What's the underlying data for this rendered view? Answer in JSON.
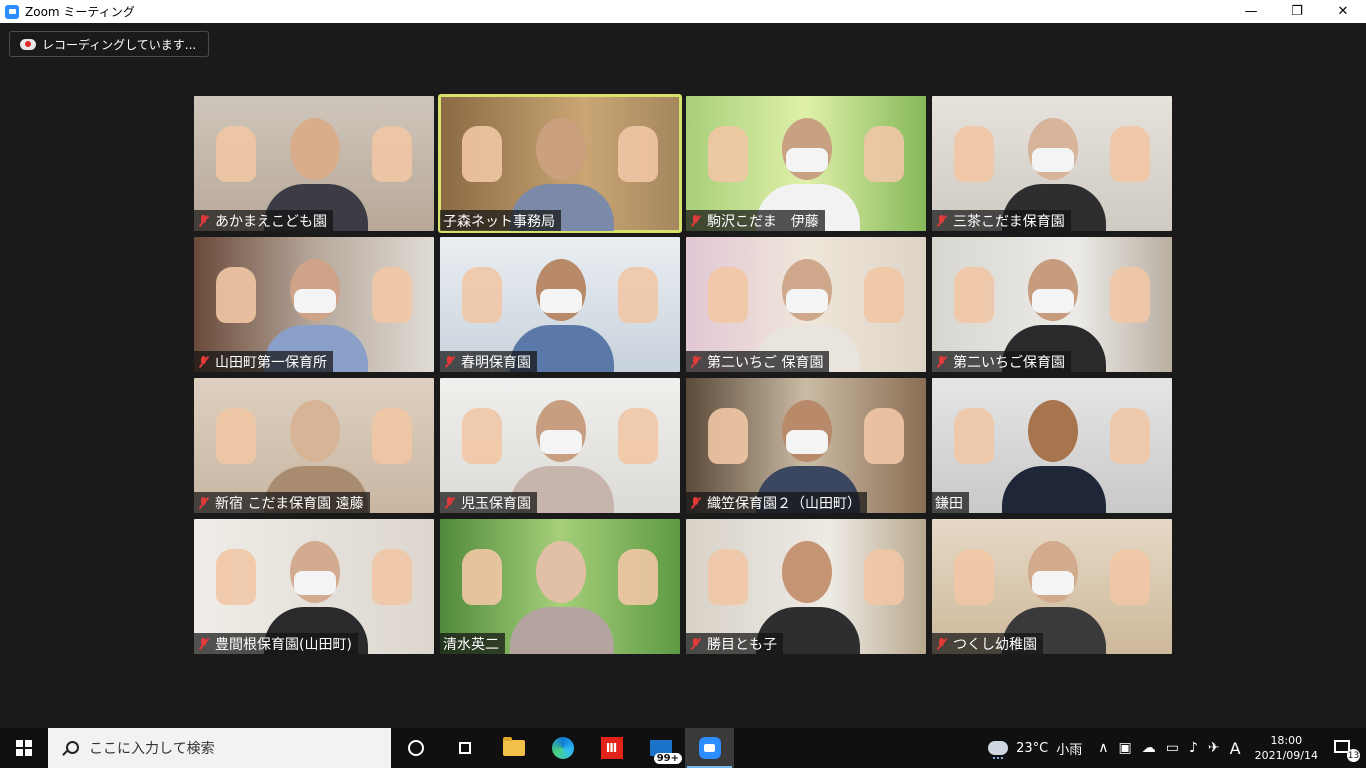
{
  "window": {
    "title": "Zoom ミーティング",
    "minimize": "—",
    "maximize": "❐",
    "close": "✕"
  },
  "recording": {
    "label": "レコーディングしています..."
  },
  "participants": [
    {
      "name": "あかまえこども園",
      "muted": true
    },
    {
      "name": "子森ネット事務局",
      "muted": false,
      "active_speaker": true
    },
    {
      "name": "駒沢こだま　伊藤",
      "muted": true
    },
    {
      "name": "三茶こだま保育園",
      "muted": true
    },
    {
      "name": "山田町第一保育所",
      "muted": true
    },
    {
      "name": "春明保育園",
      "muted": true
    },
    {
      "name": "第二いちご 保育園",
      "muted": true
    },
    {
      "name": "第二いちご保育園",
      "muted": true
    },
    {
      "name": "新宿 こだま保育園 遠藤",
      "muted": true
    },
    {
      "name": "児玉保育園",
      "muted": true
    },
    {
      "name": "織笠保育園２（山田町）",
      "muted": true
    },
    {
      "name": "鎌田",
      "muted": false
    },
    {
      "name": "豊間根保育園(山田町)",
      "muted": true
    },
    {
      "name": "清水英二",
      "muted": false
    },
    {
      "name": "勝目とも子",
      "muted": true
    },
    {
      "name": "つくし幼稚園",
      "muted": true
    }
  ],
  "taskbar": {
    "search_placeholder": "ここに入力して検索",
    "mail_badge": "99+",
    "red_app_glyph": "Ⅲ",
    "temperature": "23°C",
    "weather": "小雨",
    "ime": "A",
    "time": "18:00",
    "date": "2021/09/14",
    "notification_count": "13",
    "chevron": "∧"
  },
  "colors": {
    "background": "#1a1a1a",
    "active_speaker_border": "#d8e26b",
    "muted_icon": "#e03a3a",
    "zoom_blue": "#2d8cff"
  }
}
